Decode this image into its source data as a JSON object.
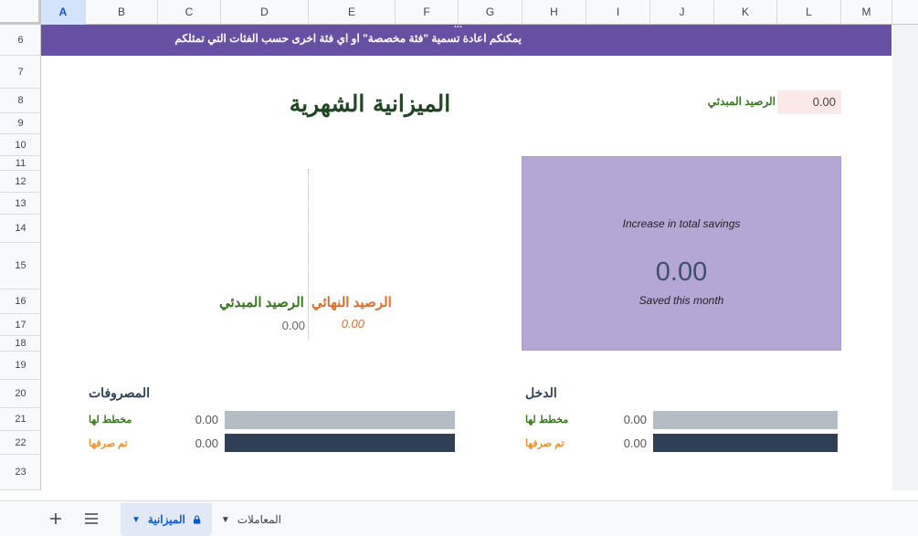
{
  "columns": [
    "A",
    "B",
    "C",
    "D",
    "E",
    "F",
    "G",
    "H",
    "I",
    "J",
    "K",
    "L",
    "M"
  ],
  "active_column": "A",
  "rows": [
    "6",
    "7",
    "8",
    "9",
    "10",
    "11",
    "12",
    "13",
    "14",
    "15",
    "16",
    "17",
    "18",
    "19",
    "20",
    "21",
    "22",
    "23"
  ],
  "banner": {
    "text": "يمكنكم اعادة تسمية \"فئة مخصصة\"  او اي فئة اخرى حسب الفئات التي تمثلكم",
    "cut_text": "..."
  },
  "title": "الميزانية الشهرية",
  "starting_balance": {
    "label": "الرصيد المبدئي",
    "value": "0.00"
  },
  "balances": {
    "start_label": "الرصيد المبدئي",
    "end_label": "الرصيد النهائي",
    "start_value": "0.00",
    "end_value": "0.00"
  },
  "savings": {
    "heading": "Increase in total savings",
    "value": "0.00",
    "caption": "Saved this month"
  },
  "expenses": {
    "title": "المصروفات",
    "planned_label": "مخطط لها",
    "planned_value": "0.00",
    "spent_label": "تم صرفها",
    "spent_value": "0.00"
  },
  "income": {
    "title": "الدخل",
    "planned_label": "مخطط لها",
    "planned_value": "0.00",
    "spent_label": "تم صرفها",
    "spent_value": "0.00"
  },
  "tabs_bar": {
    "add_icon": "plus-icon",
    "menu_icon": "menu-icon",
    "tabs": [
      {
        "label": "الميزانية",
        "icon": "lock-icon",
        "active": true
      },
      {
        "label": "المعاملات",
        "active": false
      }
    ]
  },
  "colors": {
    "banner": "#6750a4",
    "savings_box": "#b4a7d6",
    "title": "#1e4620",
    "green_label": "#38761d",
    "orange_label": "#e06c2b",
    "planned_bar": "#b4bcc4",
    "spent_bar": "#2f3f56"
  }
}
